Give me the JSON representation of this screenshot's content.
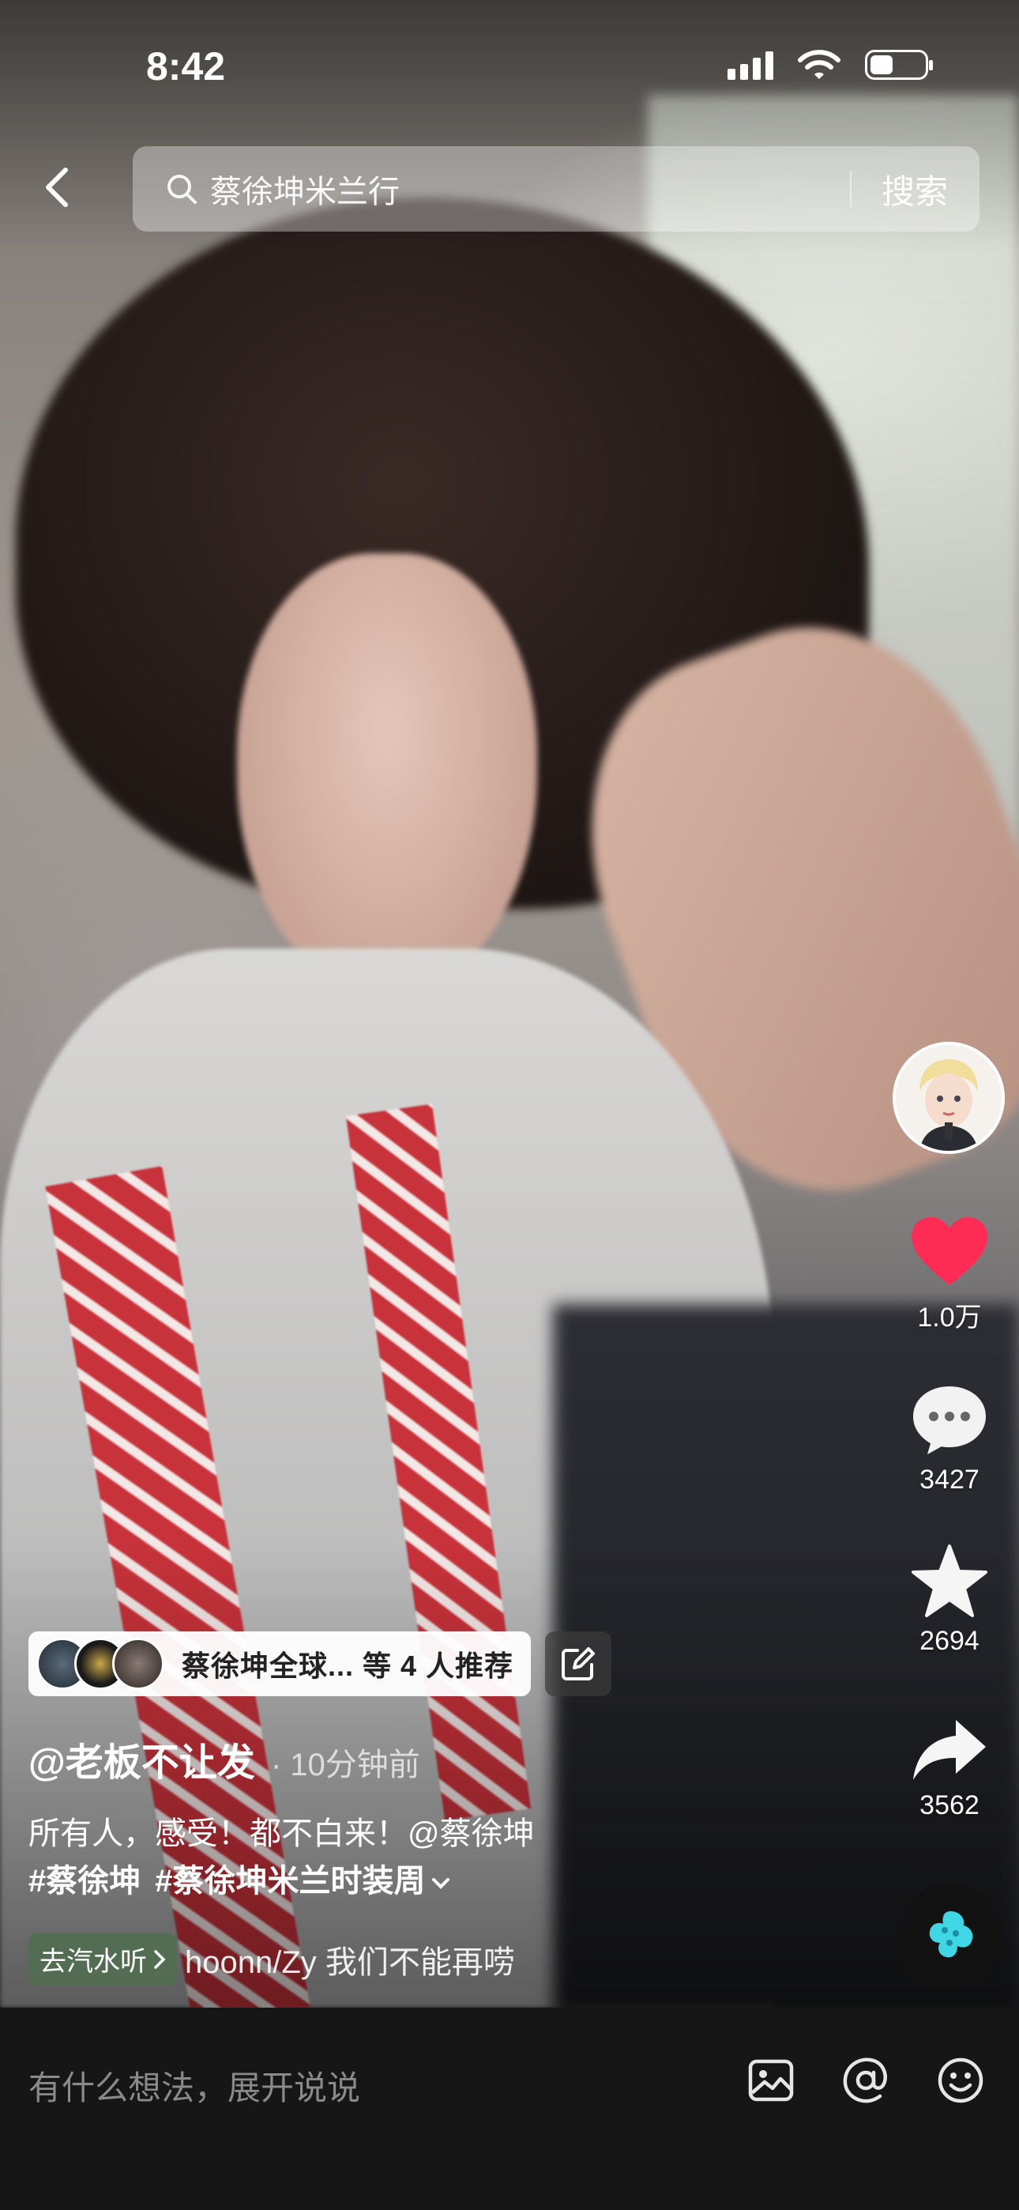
{
  "status": {
    "time": "8:42"
  },
  "search": {
    "query": "蔡徐坤米兰行",
    "button": "搜索"
  },
  "actions": {
    "likes": "1.0万",
    "comments": "3427",
    "favorites": "2694",
    "shares": "3562",
    "like_color": "#FE2C55"
  },
  "recommend": {
    "text": "蔡徐坤全球... 等 4 人推荐"
  },
  "post": {
    "author": "@老板不让发",
    "time_ago": "· 10分钟前",
    "caption": "所有人，感受！都不白来！@蔡徐坤",
    "hashtags": [
      "#蔡徐坤",
      "#蔡徐坤米兰时装周"
    ],
    "music_chip": "去汽水听",
    "music_track": "hoonn/Zy    我们不能再唠"
  },
  "comment_bar": {
    "placeholder": "有什么想法，展开说说"
  },
  "icons": [
    "back-icon",
    "search-icon",
    "heart-icon",
    "comment-icon",
    "star-icon",
    "share-icon",
    "edit-icon",
    "image-icon",
    "at-icon",
    "emoji-icon",
    "music-disc-icon"
  ]
}
